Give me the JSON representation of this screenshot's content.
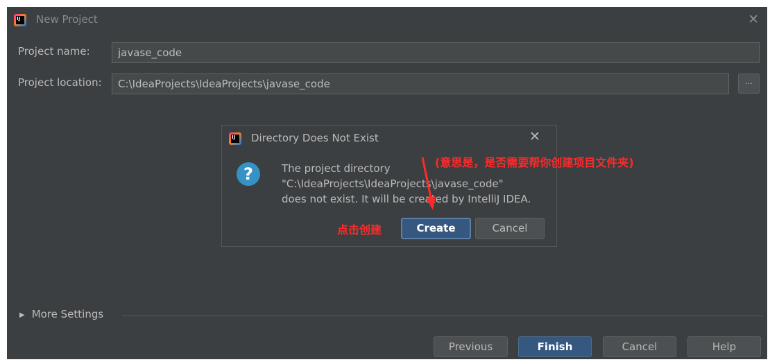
{
  "window": {
    "title": "New Project",
    "close_glyph": "✕",
    "app_icon": "intellij-icon",
    "app_icon_text": "IJ"
  },
  "form": {
    "project_name_label": "Project name:",
    "project_name_value": "javase_code",
    "project_location_label": "Project location:",
    "project_location_value": "C:\\IdeaProjects\\IdeaProjects\\javase_code",
    "browse_label": "..."
  },
  "more_settings": {
    "label": "More Settings",
    "toggle_glyph": "▶"
  },
  "footer": {
    "previous": "Previous",
    "finish": "Finish",
    "cancel": "Cancel",
    "help": "Help"
  },
  "dialog": {
    "title": "Directory Does Not Exist",
    "close_glyph": "✕",
    "icon": "question-icon",
    "icon_glyph": "?",
    "message_lines": [
      "The project directory",
      "\"C:\\IdeaProjects\\IdeaProjects\\javase_code\"",
      "does not exist. It will be created by IntelliJ IDEA."
    ],
    "create": "Create",
    "cancel": "Cancel"
  },
  "annotations": {
    "meaning": "(意思是，是否需要帮你创建项目文件夹)",
    "click_create": "点击创建",
    "color": "#ff2a2a"
  },
  "colors": {
    "background": "#3c3f41",
    "input_bg": "#45494a",
    "primary_button": "#365880",
    "question_icon": "#3592c4"
  }
}
